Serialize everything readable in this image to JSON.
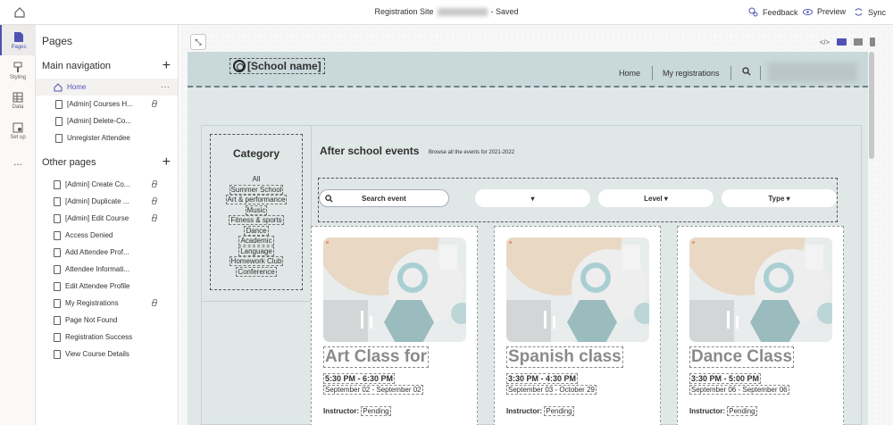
{
  "topbar": {
    "title_left": "Registration Site",
    "title_right": "- Saved",
    "feedback": "Feedback",
    "preview": "Preview",
    "sync": "Sync"
  },
  "rail": [
    "Pages",
    "Styling",
    "Data",
    "Set up",
    "..."
  ],
  "panel": {
    "title": "Pages",
    "main_nav": "Main navigation",
    "other_pages": "Other pages",
    "main_items": [
      "Home",
      "[Admin] Courses H...",
      "[Admin] Delete-Co...",
      "Unregister Attendee"
    ],
    "other_items": [
      "[Admin] Create Co...",
      "[Admin] Duplicate ...",
      "[Admin] Edit Course",
      "Access Denied",
      "Add Attendee Prof...",
      "Attendee Informati...",
      "Edit Attendee Profile",
      "My Registrations",
      "Page Not Found",
      "Registration Success",
      "View Course Details"
    ]
  },
  "site": {
    "school": "[School name]",
    "nav": [
      "Home",
      "My registrations"
    ],
    "category_title": "Category",
    "categories": [
      "All",
      "Summer School",
      "Art & performance",
      "Music",
      "Fitness & sports",
      "Dance",
      "Academic",
      "Language",
      "Homework Club",
      "Conference"
    ],
    "events_title": "After school events",
    "events_sub": "Browse all the events for 2021-2022",
    "search_placeholder": "Search event",
    "level": "Level ▾",
    "type": "Type ▾",
    "blank_caret": "▾",
    "cards": [
      {
        "title": "Art Class for",
        "time_start": "5:30 PM",
        "time_end": "6:30 PM",
        "date_start": "September 02",
        "date_end": "September 02",
        "instructor_label": "Instructor:",
        "instructor_value": "Pending"
      },
      {
        "title": "Spanish class",
        "time_start": "3:30 PM",
        "time_end": "4:30 PM",
        "date_start": "September 03",
        "date_end": "October 29",
        "instructor_label": "Instructor:",
        "instructor_value": "Pending"
      },
      {
        "title": "Dance Class",
        "time_start": "3:30 PM",
        "time_end": "5:00 PM",
        "date_start": "September 06",
        "date_end": "September 06",
        "instructor_label": "Instructor:",
        "instructor_value": "Pending"
      }
    ]
  }
}
